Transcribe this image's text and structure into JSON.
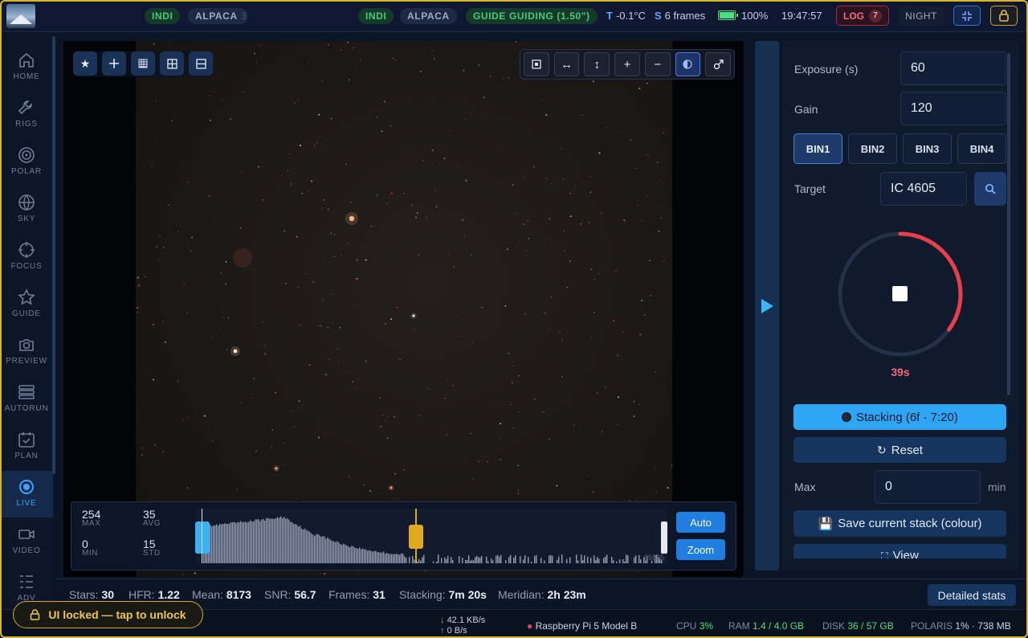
{
  "topbar": {
    "pills_left": [
      "INDI",
      "ALPACA"
    ],
    "pill_left_suffix": "3",
    "pills_right": [
      "INDI",
      "ALPACA"
    ],
    "guide_pill": "GUIDE GUIDING (1.50\")",
    "temp_label": "T",
    "temp_value": "-0.1°C",
    "frames_label": "S",
    "frames_value": "6 frames",
    "battery": "100%",
    "clock": "19:47:57",
    "log_label": "LOG",
    "log_count": "7",
    "night_label": "NIGHT",
    "icons": [
      "compress-icon",
      "lock-icon"
    ]
  },
  "sidebar": {
    "items": [
      {
        "label": "HOME",
        "icon": "home-icon"
      },
      {
        "label": "RIGS",
        "icon": "wrench-icon"
      },
      {
        "label": "POLAR",
        "icon": "target-icon"
      },
      {
        "label": "SKY",
        "icon": "globe-icon"
      },
      {
        "label": "FOCUS",
        "icon": "crosshair-icon"
      },
      {
        "label": "GUIDE",
        "icon": "star-icon"
      },
      {
        "label": "PREVIEW",
        "icon": "camera-icon"
      },
      {
        "label": "AUTORUN",
        "icon": "stack-icon"
      },
      {
        "label": "PLAN",
        "icon": "calendar-check-icon"
      },
      {
        "label": "LIVE",
        "icon": "live-dot-icon",
        "active": true
      },
      {
        "label": "VIDEO",
        "icon": "video-icon"
      },
      {
        "label": "ADV",
        "icon": "list-icon"
      }
    ]
  },
  "viewer": {
    "left_tools": [
      "star-icon",
      "crosshair-plus-icon",
      "grid-small-icon",
      "grid-icon",
      "split-icon"
    ],
    "right_tools": [
      "fit-icon",
      "stretch-horizontal-icon",
      "stretch-vertical-icon",
      "zoom-in-icon",
      "zoom-out-icon",
      "color-balance-icon",
      "expand-icon"
    ]
  },
  "histogram": {
    "max_value": "254",
    "max_label": "MAX",
    "avg_value": "35",
    "avg_label": "AVG",
    "min_value": "0",
    "min_label": "MIN",
    "std_value": "15",
    "std_label": "STD",
    "right_value": "65535",
    "auto_label": "Auto",
    "zoom_label": "Zoom"
  },
  "panel": {
    "exposure_label": "Exposure (s)",
    "exposure_value": "60",
    "gain_label": "Gain",
    "gain_value": "120",
    "bins": [
      "BIN1",
      "BIN2",
      "BIN3",
      "BIN4"
    ],
    "target_label": "Target",
    "target_value": "IC 4605",
    "countdown": "39s",
    "countdown_fraction_remaining": 0.35,
    "stacking_label": "Stacking (6f · 7:20)",
    "reset_label": "Reset",
    "max_label": "Max",
    "max_value": "0",
    "max_unit": "min",
    "save_label": "Save current stack (colour)",
    "view_label": "View"
  },
  "stats": {
    "stars_label": "Stars:",
    "stars_value": "30",
    "hfr_label": "HFR:",
    "hfr_value": "1.22",
    "mean_label": "Mean:",
    "mean_value": "8173",
    "snr_label": "SNR:",
    "snr_value": "56.7",
    "frames_label": "Frames:",
    "frames_value": "31",
    "stacking_label": "Stacking:",
    "stacking_value": "7m 20s",
    "meridian_label": "Meridian:",
    "meridian_value": "2h 23m",
    "detail_button": "Detailed stats"
  },
  "footer": {
    "unlock_label": "UI locked — tap to unlock",
    "net_down": "42.1 KB/s",
    "net_up": "0 B/s",
    "device": "Raspberry Pi 5 Model B",
    "cpu_label": "CPU",
    "cpu_value": "3%",
    "ram_label": "RAM",
    "ram_value": "1.4 / 4.0 GB",
    "disk_label": "DISK",
    "disk_value": "36 / 57 GB",
    "polaris_label": "POLARIS",
    "polaris_value": "1% · 738 MB"
  },
  "colors": {
    "accent": "#2ea6f5",
    "ok": "#48c97a",
    "warn": "#d8b52b",
    "error": "#f26a7c"
  }
}
